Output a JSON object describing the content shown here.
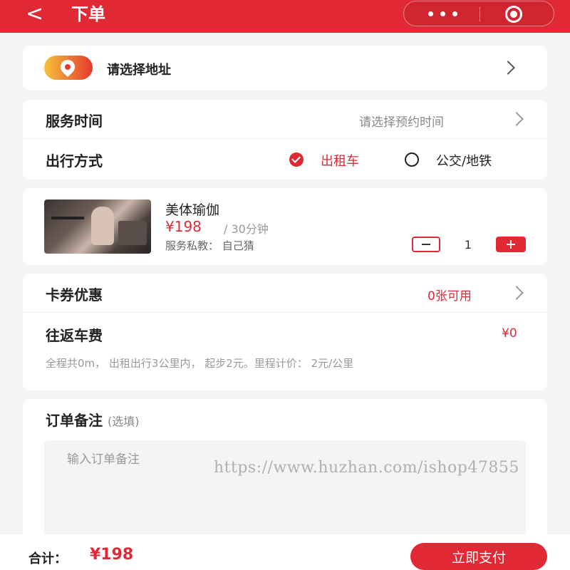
{
  "header": {
    "back_label": "<",
    "title": "下单",
    "menu_icon": "more-dots-icon",
    "target_icon": "target-icon"
  },
  "address": {
    "label": "请选择地址",
    "icon": "location-pin-icon"
  },
  "service_time": {
    "label": "服务时间",
    "value": "请选择预约时间"
  },
  "travel": {
    "label": "出行方式",
    "options": [
      {
        "label": "出租车",
        "selected": true
      },
      {
        "label": "公交/地铁",
        "selected": false
      }
    ]
  },
  "product": {
    "name": "美体瑜伽",
    "price": "¥198",
    "unit": "/ 30分钟",
    "trainer": "服务私教：  自己猜",
    "quantity": "1"
  },
  "coupon": {
    "label": "卡券优惠",
    "value": "0张可用"
  },
  "fare": {
    "label": "往返车费",
    "value": "¥0",
    "note": "全程共0m，  出租出行3公里内，  起步2元。里程计价：  2元/公里"
  },
  "remark": {
    "title": "订单备注",
    "hint": "(选填)",
    "placeholder": "输入订单备注"
  },
  "watermark": "https://www.huzhan.com/ishop47855",
  "footer": {
    "total_label": "合计：",
    "total_value": "¥198",
    "pay_label": "立即支付"
  },
  "colors": {
    "accent": "#e02935",
    "background": "#f5f5f5"
  }
}
